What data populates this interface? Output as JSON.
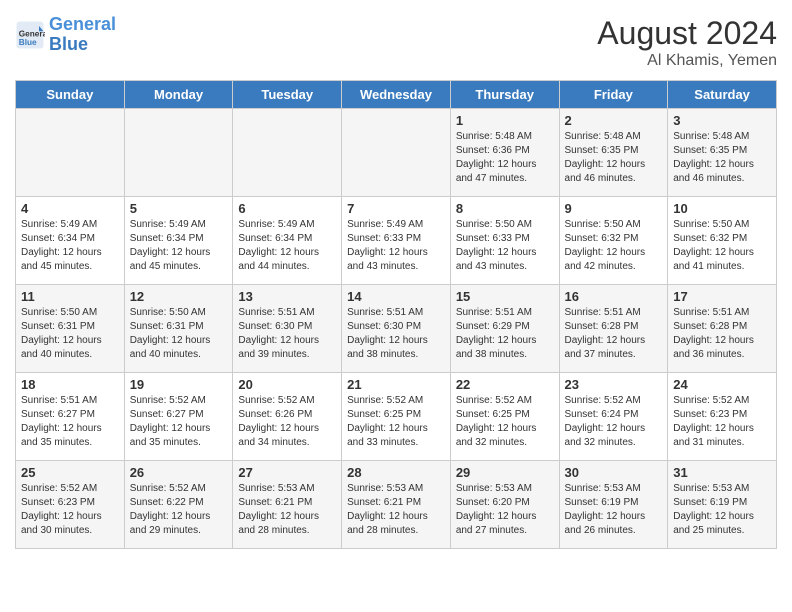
{
  "logo": {
    "text_general": "General",
    "text_blue": "Blue"
  },
  "header": {
    "month_year": "August 2024",
    "location": "Al Khamis, Yemen"
  },
  "days_of_week": [
    "Sunday",
    "Monday",
    "Tuesday",
    "Wednesday",
    "Thursday",
    "Friday",
    "Saturday"
  ],
  "weeks": [
    [
      {
        "day": "",
        "info": ""
      },
      {
        "day": "",
        "info": ""
      },
      {
        "day": "",
        "info": ""
      },
      {
        "day": "",
        "info": ""
      },
      {
        "day": "1",
        "info": "Sunrise: 5:48 AM\nSunset: 6:36 PM\nDaylight: 12 hours\nand 47 minutes."
      },
      {
        "day": "2",
        "info": "Sunrise: 5:48 AM\nSunset: 6:35 PM\nDaylight: 12 hours\nand 46 minutes."
      },
      {
        "day": "3",
        "info": "Sunrise: 5:48 AM\nSunset: 6:35 PM\nDaylight: 12 hours\nand 46 minutes."
      }
    ],
    [
      {
        "day": "4",
        "info": "Sunrise: 5:49 AM\nSunset: 6:34 PM\nDaylight: 12 hours\nand 45 minutes."
      },
      {
        "day": "5",
        "info": "Sunrise: 5:49 AM\nSunset: 6:34 PM\nDaylight: 12 hours\nand 45 minutes."
      },
      {
        "day": "6",
        "info": "Sunrise: 5:49 AM\nSunset: 6:34 PM\nDaylight: 12 hours\nand 44 minutes."
      },
      {
        "day": "7",
        "info": "Sunrise: 5:49 AM\nSunset: 6:33 PM\nDaylight: 12 hours\nand 43 minutes."
      },
      {
        "day": "8",
        "info": "Sunrise: 5:50 AM\nSunset: 6:33 PM\nDaylight: 12 hours\nand 43 minutes."
      },
      {
        "day": "9",
        "info": "Sunrise: 5:50 AM\nSunset: 6:32 PM\nDaylight: 12 hours\nand 42 minutes."
      },
      {
        "day": "10",
        "info": "Sunrise: 5:50 AM\nSunset: 6:32 PM\nDaylight: 12 hours\nand 41 minutes."
      }
    ],
    [
      {
        "day": "11",
        "info": "Sunrise: 5:50 AM\nSunset: 6:31 PM\nDaylight: 12 hours\nand 40 minutes."
      },
      {
        "day": "12",
        "info": "Sunrise: 5:50 AM\nSunset: 6:31 PM\nDaylight: 12 hours\nand 40 minutes."
      },
      {
        "day": "13",
        "info": "Sunrise: 5:51 AM\nSunset: 6:30 PM\nDaylight: 12 hours\nand 39 minutes."
      },
      {
        "day": "14",
        "info": "Sunrise: 5:51 AM\nSunset: 6:30 PM\nDaylight: 12 hours\nand 38 minutes."
      },
      {
        "day": "15",
        "info": "Sunrise: 5:51 AM\nSunset: 6:29 PM\nDaylight: 12 hours\nand 38 minutes."
      },
      {
        "day": "16",
        "info": "Sunrise: 5:51 AM\nSunset: 6:28 PM\nDaylight: 12 hours\nand 37 minutes."
      },
      {
        "day": "17",
        "info": "Sunrise: 5:51 AM\nSunset: 6:28 PM\nDaylight: 12 hours\nand 36 minutes."
      }
    ],
    [
      {
        "day": "18",
        "info": "Sunrise: 5:51 AM\nSunset: 6:27 PM\nDaylight: 12 hours\nand 35 minutes."
      },
      {
        "day": "19",
        "info": "Sunrise: 5:52 AM\nSunset: 6:27 PM\nDaylight: 12 hours\nand 35 minutes."
      },
      {
        "day": "20",
        "info": "Sunrise: 5:52 AM\nSunset: 6:26 PM\nDaylight: 12 hours\nand 34 minutes."
      },
      {
        "day": "21",
        "info": "Sunrise: 5:52 AM\nSunset: 6:25 PM\nDaylight: 12 hours\nand 33 minutes."
      },
      {
        "day": "22",
        "info": "Sunrise: 5:52 AM\nSunset: 6:25 PM\nDaylight: 12 hours\nand 32 minutes."
      },
      {
        "day": "23",
        "info": "Sunrise: 5:52 AM\nSunset: 6:24 PM\nDaylight: 12 hours\nand 32 minutes."
      },
      {
        "day": "24",
        "info": "Sunrise: 5:52 AM\nSunset: 6:23 PM\nDaylight: 12 hours\nand 31 minutes."
      }
    ],
    [
      {
        "day": "25",
        "info": "Sunrise: 5:52 AM\nSunset: 6:23 PM\nDaylight: 12 hours\nand 30 minutes."
      },
      {
        "day": "26",
        "info": "Sunrise: 5:52 AM\nSunset: 6:22 PM\nDaylight: 12 hours\nand 29 minutes."
      },
      {
        "day": "27",
        "info": "Sunrise: 5:53 AM\nSunset: 6:21 PM\nDaylight: 12 hours\nand 28 minutes."
      },
      {
        "day": "28",
        "info": "Sunrise: 5:53 AM\nSunset: 6:21 PM\nDaylight: 12 hours\nand 28 minutes."
      },
      {
        "day": "29",
        "info": "Sunrise: 5:53 AM\nSunset: 6:20 PM\nDaylight: 12 hours\nand 27 minutes."
      },
      {
        "day": "30",
        "info": "Sunrise: 5:53 AM\nSunset: 6:19 PM\nDaylight: 12 hours\nand 26 minutes."
      },
      {
        "day": "31",
        "info": "Sunrise: 5:53 AM\nSunset: 6:19 PM\nDaylight: 12 hours\nand 25 minutes."
      }
    ]
  ]
}
